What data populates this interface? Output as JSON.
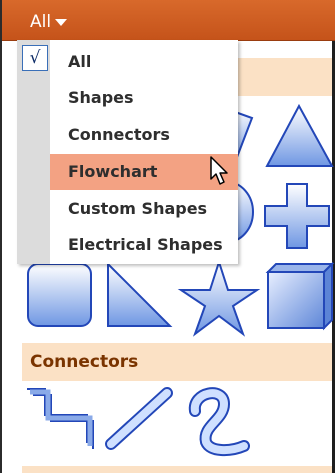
{
  "topbar": {
    "filter_label": "All"
  },
  "sections": {
    "connectors_label": "Connectors"
  },
  "menu": {
    "items": [
      {
        "label": "All",
        "checked": true
      },
      {
        "label": "Shapes"
      },
      {
        "label": "Connectors"
      },
      {
        "label": "Flowchart",
        "highlighted": true
      },
      {
        "label": "Custom Shapes"
      },
      {
        "label": "Electrical Shapes"
      }
    ],
    "check_glyph": "√"
  },
  "colors": {
    "topbar": "#c5531a",
    "section_header_bg": "#fbe1c5",
    "section_header_text": "#7a3400",
    "shape_fill_top": "#ffffff",
    "shape_fill_bottom": "#6f97e3",
    "shape_stroke": "#2347b8",
    "menu_highlight": "#f3a283"
  },
  "icons": [
    "chevron-down-icon",
    "checkmark-icon",
    "mouse-cursor-icon"
  ]
}
